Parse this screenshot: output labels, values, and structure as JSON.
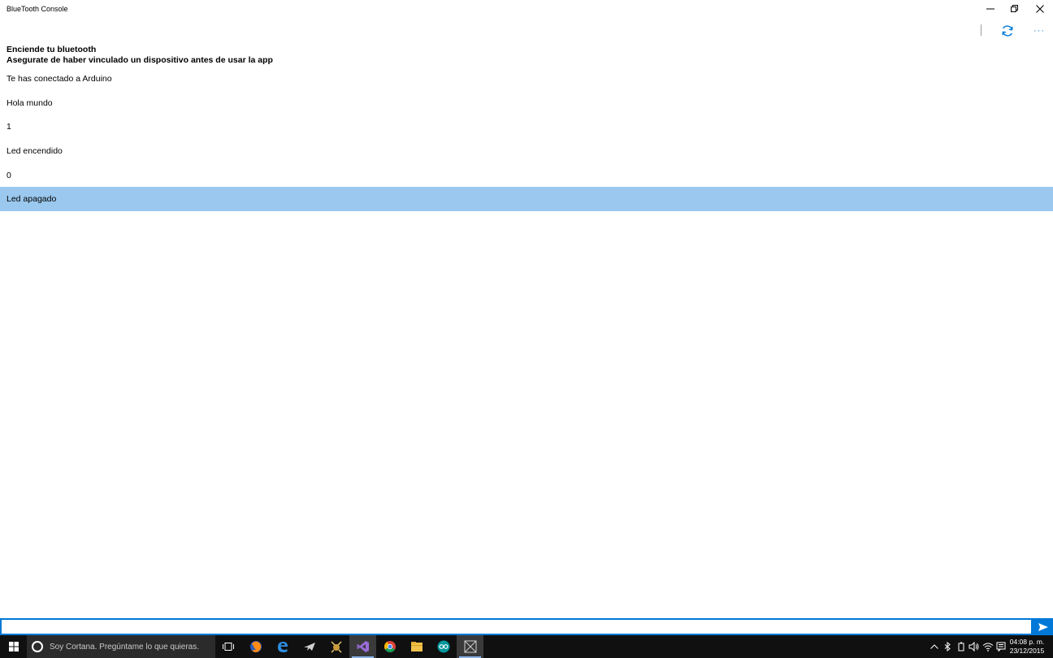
{
  "window": {
    "title": "BlueTooth Console",
    "controls": [
      "minimize",
      "restore",
      "close"
    ]
  },
  "commandbar": {
    "refresh_icon": "refresh-icon",
    "more_label": "···"
  },
  "header": {
    "line1": "Enciende tu bluetooth",
    "line2": "Asegurate de haber vinculado un dispositivo antes de usar la app"
  },
  "messages": [
    "Te has conectado a Arduino",
    "Hola mundo",
    "1",
    "Led encendido",
    "0",
    "Led apagado"
  ],
  "selected_index": 5,
  "input": {
    "value": "",
    "placeholder": ""
  },
  "colors": {
    "accent": "#0078d7",
    "selected_row": "#9ac8ee",
    "taskbar": "#101010"
  },
  "taskbar": {
    "cortana_text": "Soy Cortana. Pregúntame lo que quieras.",
    "apps": [
      "task-view-icon",
      "firefox-icon",
      "edge-icon",
      "plane-icon",
      "game-icon",
      "visual-studio-icon",
      "chrome-icon",
      "file-explorer-icon",
      "arduino-icon",
      "bluetooth-console-icon"
    ],
    "clock_time": "04:08 p. m.",
    "clock_date": "23/12/2015"
  }
}
